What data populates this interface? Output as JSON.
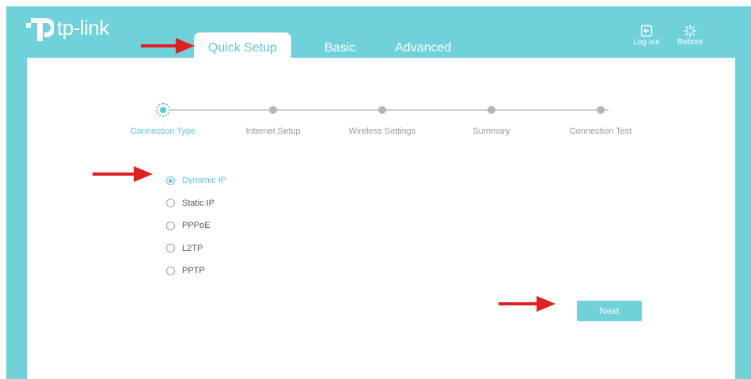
{
  "brand": {
    "logo_text": "tp-link"
  },
  "tabs": [
    {
      "label": "Quick Setup",
      "active": true
    },
    {
      "label": "Basic",
      "active": false
    },
    {
      "label": "Advanced",
      "active": false
    }
  ],
  "header_actions": {
    "logout_label": "Log out",
    "reboot_label": "Reboot"
  },
  "steps": [
    {
      "label": "Connection Type",
      "active": true
    },
    {
      "label": "Internet Setup",
      "active": false
    },
    {
      "label": "Wireless Settings",
      "active": false
    },
    {
      "label": "Summary",
      "active": false
    },
    {
      "label": "Connection Test",
      "active": false
    }
  ],
  "connection_types": [
    {
      "label": "Dynamic IP",
      "selected": true
    },
    {
      "label": "Static IP",
      "selected": false
    },
    {
      "label": "PPPoE",
      "selected": false
    },
    {
      "label": "L2TP",
      "selected": false
    },
    {
      "label": "PPTP",
      "selected": false
    }
  ],
  "next_label": "Next",
  "colors": {
    "accent": "#6fd1d9",
    "accent_text": "#5fc9d6",
    "annotation_arrow": "#e02020"
  }
}
